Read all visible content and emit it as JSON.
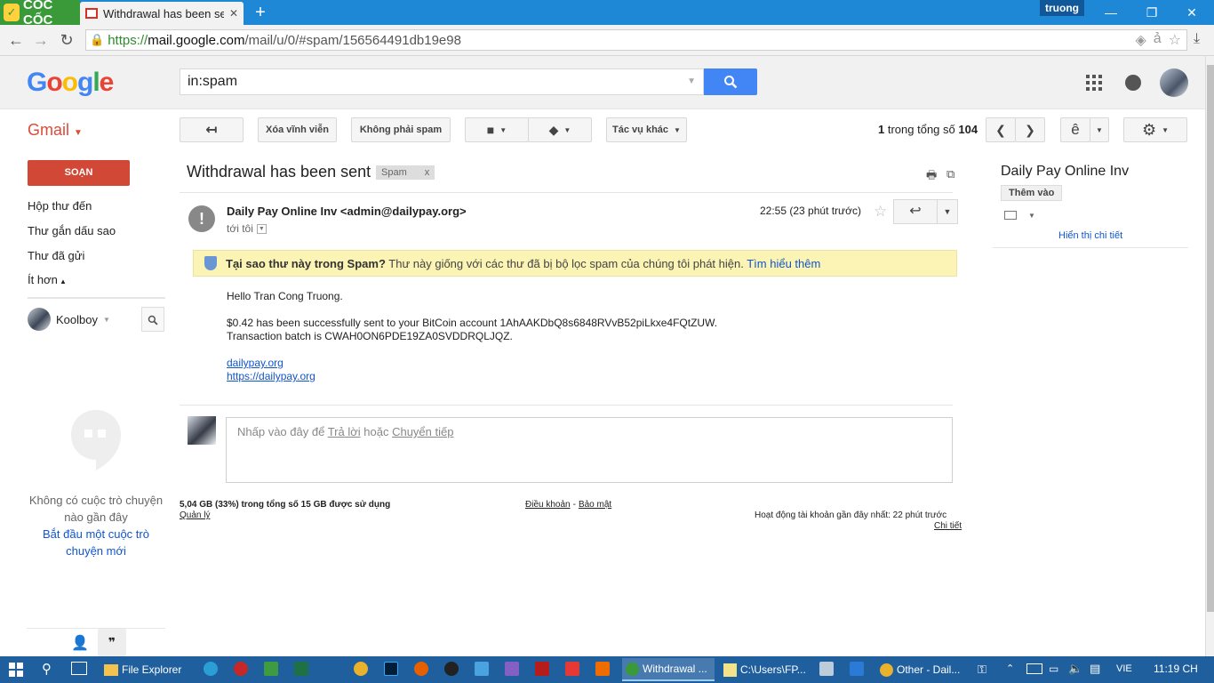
{
  "browser": {
    "brand": "CỐC CỐC",
    "tab_title": "Withdrawal has been sent",
    "user_badge": "truong",
    "url_https": "https://",
    "url_host": "mail.google.com",
    "url_path": "/mail/u/0/#spam/156564491db19e98"
  },
  "header": {
    "logo": "Google",
    "search_query": "in:spam"
  },
  "toolbar": {
    "gmail_label": "Gmail",
    "delete_forever": "Xóa vĩnh viễn",
    "not_spam": "Không phải spam",
    "more_actions": "Tác vụ khác",
    "page_current": "1",
    "page_of": "trong tổng số",
    "page_total": "104",
    "input_tool": "ê"
  },
  "sidebar": {
    "compose": "SOẠN",
    "items": [
      {
        "label": "Hộp thư đến"
      },
      {
        "label": "Thư gắn dấu sao"
      },
      {
        "label": "Thư đã gửi"
      },
      {
        "label": "Ít hơn"
      }
    ],
    "chat_user": "Koolboy",
    "no_chats": "Không có cuộc trò chuyện nào gần đây",
    "start_chat": "Bắt đầu một cuộc trò chuyện mới"
  },
  "message": {
    "subject": "Withdrawal has been sent",
    "label": "Spam",
    "label_close": "x",
    "sender": "Daily Pay Online Inv <admin@dailypay.org>",
    "to": "tới tôi",
    "time": "22:55 (23 phút trước)",
    "warning_bold": "Tại sao thư này trong Spam?",
    "warning_text": "Thư này giống với các thư đã bị bộ lọc spam của chúng tôi phát hiện.",
    "warning_link": "Tìm hiểu thêm",
    "body": {
      "greeting": "Hello Tran Cong Truong.",
      "line1": "$0.42 has been successfully sent to your BitCoin account 1AhAAKDbQ8s6848RVvB52piLkxe4FQtZUW.",
      "line2": "Transaction batch is CWAH0ON6PDE19ZA0SVDDRQLJQZ.",
      "link1": "dailypay.org",
      "link2": "https://dailypay.org"
    },
    "reply_prompt": "Nhấp vào đây để",
    "reply_link": "Trả lời",
    "reply_or": "hoặc",
    "forward_link": "Chuyển tiếp"
  },
  "footer": {
    "storage": "5,04 GB (33%) trong tổng số 15 GB được sử dụng",
    "manage": "Quản lý",
    "terms": "Điều khoản",
    "separator": "-",
    "privacy": "Bảo mật",
    "last_activity": "Hoạt động tài khoản gần đây nhất: 22 phút trước",
    "details": "Chi tiết"
  },
  "contact_panel": {
    "name": "Daily Pay Online Inv",
    "add": "Thêm vào",
    "show_details": "Hiển thị chi tiết"
  },
  "taskbar": {
    "file_explorer": "File Explorer",
    "app_withdrawal": "Withdrawal ...",
    "app_path": "C:\\Users\\FP...",
    "app_other": "Other - Dail...",
    "lang": "VIE",
    "time": "11:19 CH"
  },
  "colors": {
    "compose": "#d14836",
    "link": "#1155cc",
    "spam_warning_bg": "#fbf4b4",
    "search_button": "#4285f4",
    "taskbar": "#1f5f9e"
  }
}
